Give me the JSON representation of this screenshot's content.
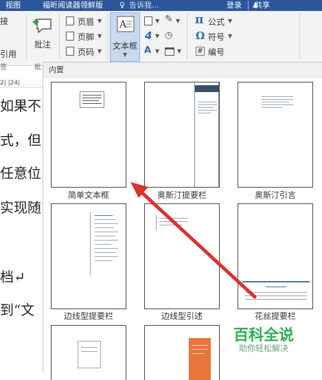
{
  "tabs": {
    "view": "视图",
    "foxit": "福昕阅读器领鲜版",
    "tell_me": "告诉我...",
    "login": "登录",
    "share": "共享"
  },
  "ribbon": {
    "left_labels": [
      "接",
      "引用"
    ],
    "left_group_label": "签",
    "comment_label": "批注",
    "comment_group_label": "批",
    "header_label": "页眉",
    "footer_label": "页脚",
    "page_number_label": "页码",
    "textbox_label": "文本框",
    "formula_label": "公式",
    "symbol_label": "符号",
    "numbering_label": "编号",
    "pi_glyph": "π",
    "omega_glyph": "Ω",
    "wordart_glyph": "4",
    "hash_glyph": "#"
  },
  "ruler": {
    "marks": "2|  |24|"
  },
  "document_lines": [
    "如果不",
    "式，但",
    "任意位",
    "实现随",
    "档↵",
    "到“文"
  ],
  "gallery": {
    "header": "内置",
    "items": [
      {
        "label": "简单文本框"
      },
      {
        "label": "奥斯汀提要栏"
      },
      {
        "label": "奥斯汀引言"
      },
      {
        "label": "边线型提要栏"
      },
      {
        "label": "边线型引述"
      },
      {
        "label": "花丝提要栏"
      }
    ]
  },
  "watermark": {
    "title": "百科全说",
    "subtitle": "助你轻松解决"
  },
  "colors": {
    "title_bar": "#2b579a",
    "arrow": "#d9322f",
    "watermark": "#2eae56",
    "accent_orange": "#e8753a"
  }
}
